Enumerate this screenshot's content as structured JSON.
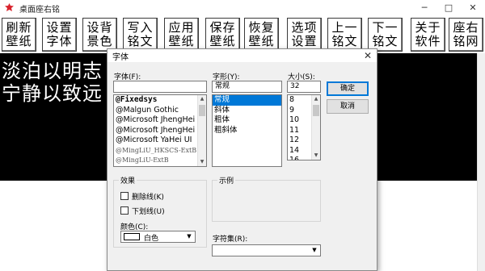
{
  "app": {
    "title": "桌面座右铭",
    "minimize": "─",
    "maximize": "□",
    "close": "✕"
  },
  "toolbar": [
    {
      "line1": "刷新",
      "line2": "壁纸"
    },
    {
      "line1": "设置",
      "line2": "字体"
    },
    {
      "line1": "设背",
      "line2": "景色"
    },
    {
      "line1": "写入",
      "line2": "铭文"
    },
    {
      "line1": "应用",
      "line2": "壁纸"
    },
    {
      "line1": "保存",
      "line2": "壁纸"
    },
    {
      "line1": "恢复",
      "line2": "壁纸"
    },
    {
      "line1": "选项",
      "line2": "设置"
    },
    {
      "line1": "上一",
      "line2": "铭文"
    },
    {
      "line1": "下一",
      "line2": "铭文"
    },
    {
      "line1": "关于",
      "line2": "软件"
    },
    {
      "line1": "座右",
      "line2": "铭网"
    }
  ],
  "motto": {
    "line1": "淡泊以明志",
    "line2": "宁静以致远"
  },
  "font_dialog": {
    "title": "字体",
    "close": "✕",
    "font_label": "字体(F):",
    "font_value": "",
    "style_label": "字形(Y):",
    "style_value": "常规",
    "size_label": "大小(S):",
    "size_value": "32",
    "fonts": [
      "@Fixedsys",
      "@Malgun Gothic",
      "@Microsoft JhengHei",
      "@Microsoft JhengHei",
      "@Microsoft YaHei UI",
      "@MingLiU_HKSCS-ExtB",
      "@MingLiU-ExtB"
    ],
    "styles": [
      "常规",
      "斜体",
      "粗体",
      "粗斜体"
    ],
    "selected_style": "常规",
    "sizes": [
      "8",
      "9",
      "10",
      "11",
      "12",
      "14",
      "16"
    ],
    "ok": "确定",
    "cancel": "取消",
    "effects_label": "效果",
    "strikeout_label": "删除线(K)",
    "underline_label": "下划线(U)",
    "color_label": "颜色(C):",
    "color_value": "白色",
    "sample_label": "示例",
    "script_label": "字符集(R):",
    "script_value": ""
  },
  "colors": {
    "selection": "#0078d7",
    "motto_bg": "#000000",
    "motto_text": "#ffffff",
    "icon_red": "#d9232d"
  }
}
